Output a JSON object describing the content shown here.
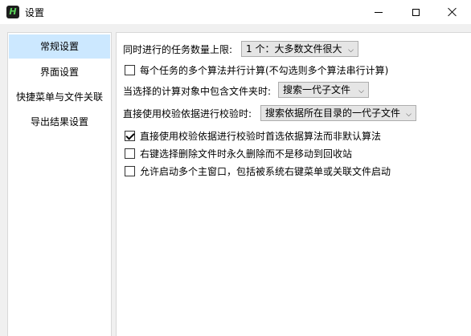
{
  "window": {
    "title": "设置",
    "app_icon_letter": "H"
  },
  "sidebar": {
    "items": [
      {
        "label": "常规设置",
        "active": true
      },
      {
        "label": "界面设置",
        "active": false
      },
      {
        "label": "快捷菜单与文件关联",
        "active": false
      },
      {
        "label": "导出结果设置",
        "active": false
      }
    ]
  },
  "settings": {
    "task_limit_label": "同时进行的任务数量上限:",
    "task_limit_value": "1 个：大多数文件很大",
    "parallel_algorithms_label": "每个任务的多个算法并行计算(不勾选则多个算法串行计算)",
    "parallel_algorithms_checked": false,
    "folder_selection_label": "当选择的计算对象中包含文件夹时:",
    "folder_selection_value": "搜索一代子文件",
    "verify_basis_label": "直接使用校验依据进行校验时:",
    "verify_basis_value": "搜索依据所在目录的一代子文件",
    "prefer_basis_algorithm_label": "直接使用校验依据进行校验时首选依据算法而非默认算法",
    "prefer_basis_algorithm_checked": true,
    "permanent_delete_label": "右键选择删除文件时永久删除而不是移动到回收站",
    "permanent_delete_checked": false,
    "multi_window_label": "允许启动多个主窗口，包括被系统右键菜单或关联文件启动",
    "multi_window_checked": false
  }
}
